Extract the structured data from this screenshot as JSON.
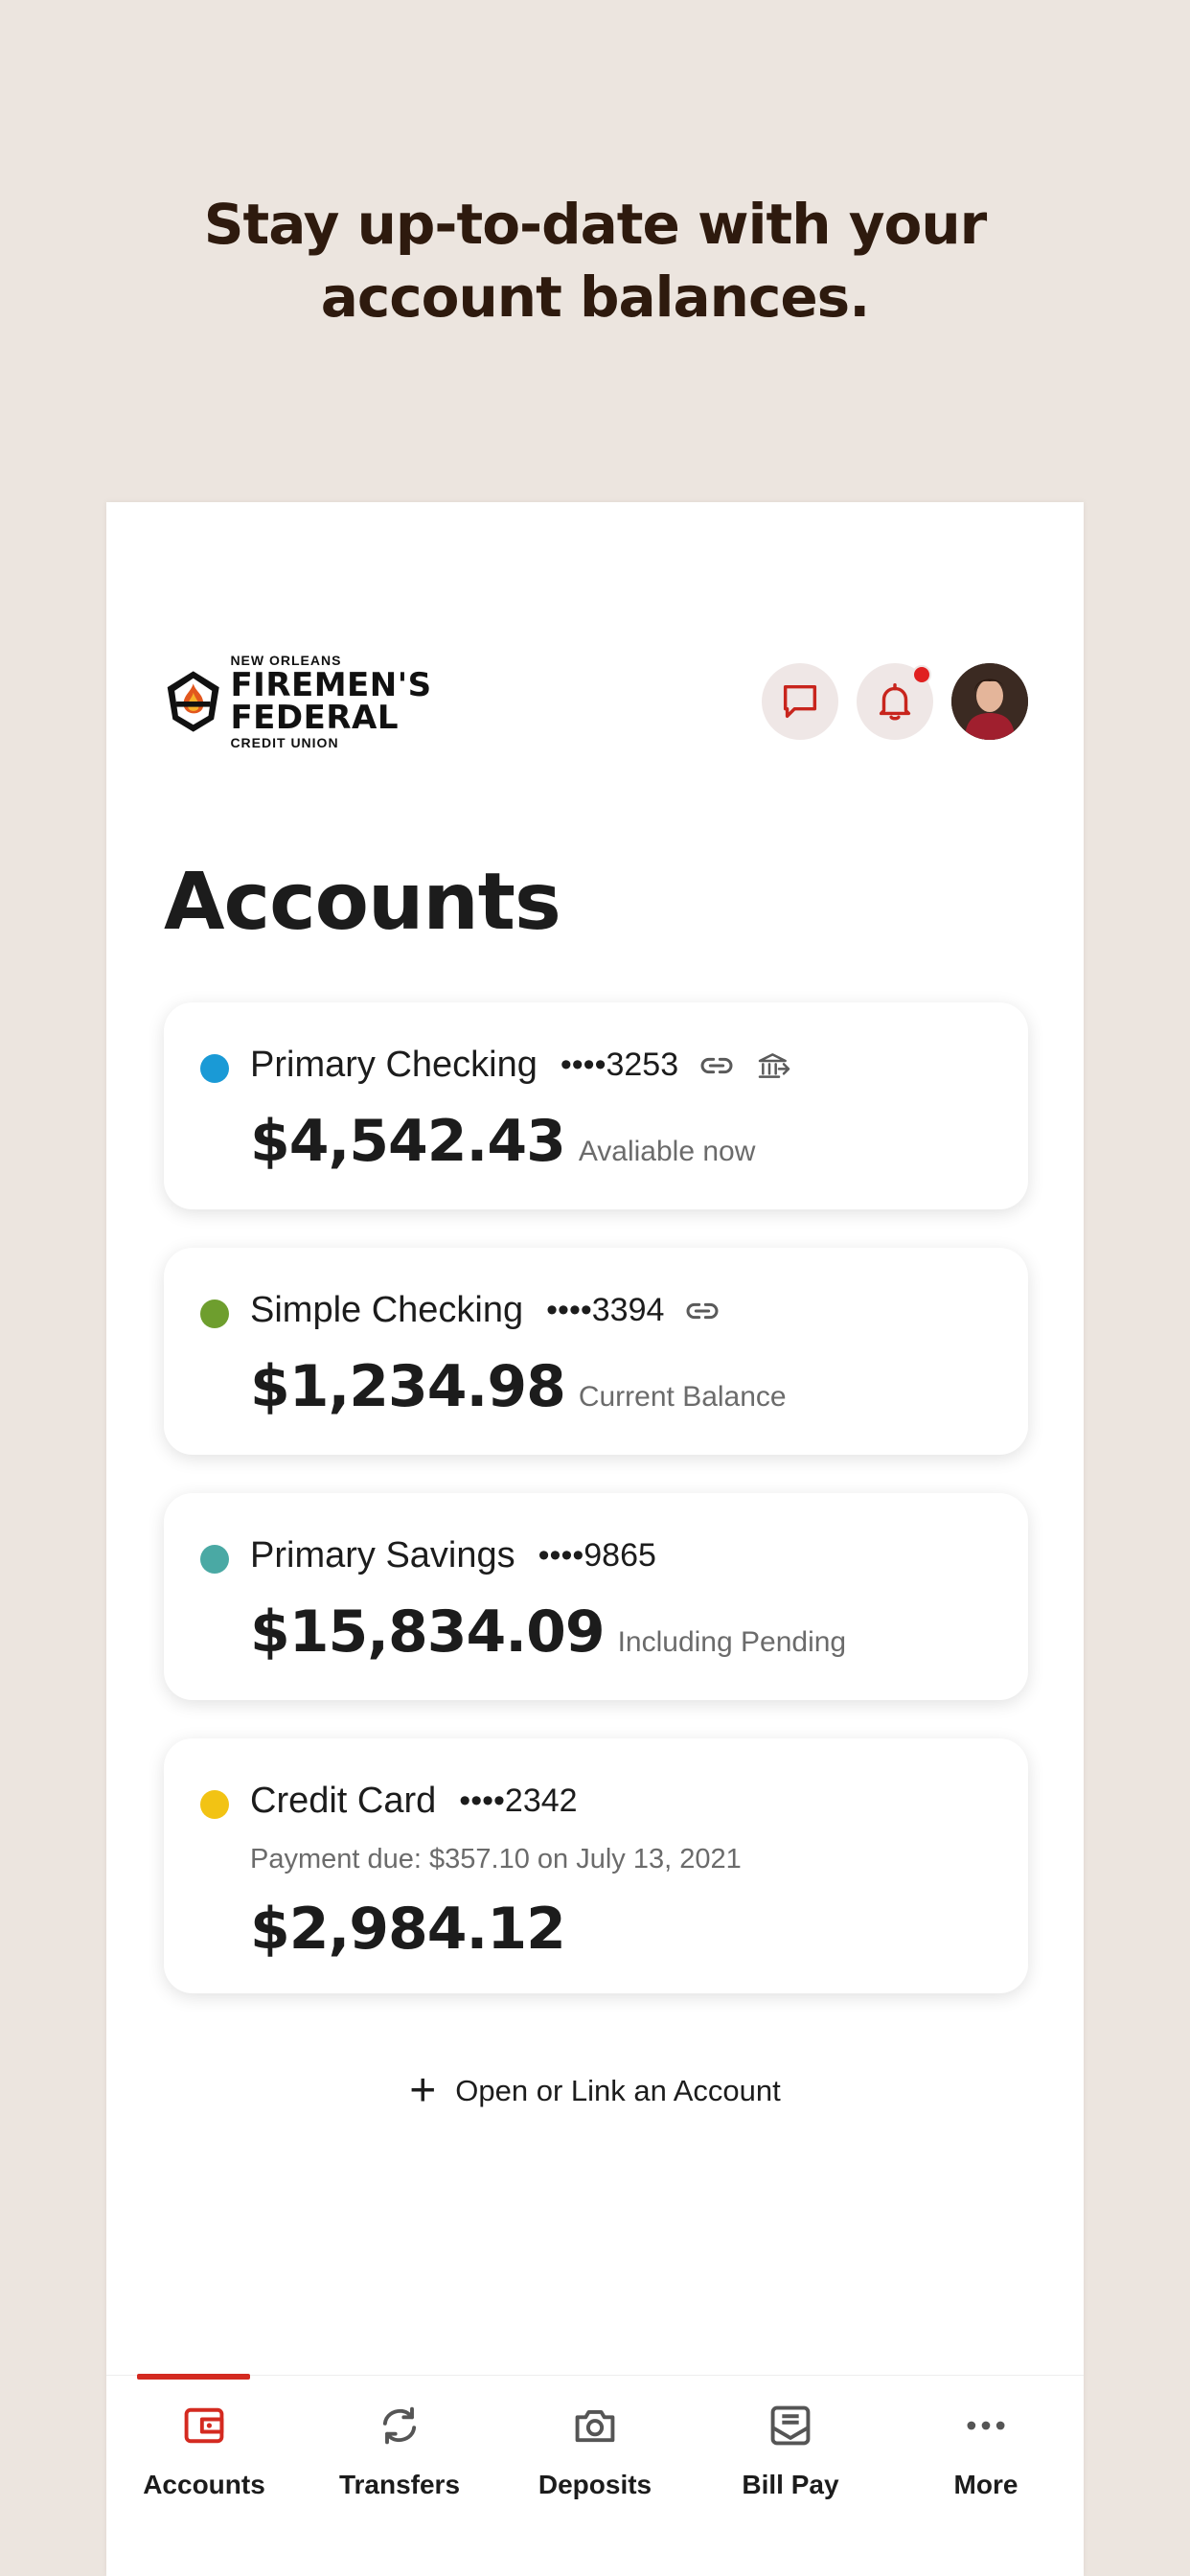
{
  "promo": {
    "headline_line1": "Stay up-to-date with your",
    "headline_line2": "account balances."
  },
  "header": {
    "logo": {
      "top_text": "NEW ORLEANS",
      "main_text": "FIREMEN'S FEDERAL",
      "bottom_text": "CREDIT UNION"
    },
    "icons": [
      "chat-icon",
      "bell-icon",
      "avatar"
    ],
    "notification_badge": true
  },
  "page": {
    "title": "Accounts"
  },
  "accounts": [
    {
      "name": "Primary Checking",
      "mask": "••••3253",
      "amount": "$4,542.43",
      "note": "Avaliable now",
      "color": "#1a9ad6",
      "icons": [
        "link-icon",
        "bank-transfer-icon"
      ]
    },
    {
      "name": "Simple Checking",
      "mask": "••••3394",
      "amount": "$1,234.98",
      "note": "Current Balance",
      "color": "#6e9e2e",
      "icons": [
        "link-icon"
      ]
    },
    {
      "name": "Primary Savings",
      "mask": "••••9865",
      "amount": "$15,834.09",
      "note": "Including Pending",
      "color": "#4aa9a4",
      "icons": []
    },
    {
      "name": "Credit Card",
      "mask": "••••2342",
      "due_text": "Payment due: $357.10 on July 13, 2021",
      "amount": "$2,984.12",
      "color": "#f2c314",
      "icons": []
    }
  ],
  "open_link": {
    "label": "Open or Link an Account"
  },
  "bottom_nav": {
    "active_color": "#d42a20",
    "items": [
      {
        "label": "Accounts",
        "icon": "wallet-icon",
        "active": true
      },
      {
        "label": "Transfers",
        "icon": "transfer-icon",
        "active": false
      },
      {
        "label": "Deposits",
        "icon": "camera-icon",
        "active": false
      },
      {
        "label": "Bill Pay",
        "icon": "bill-icon",
        "active": false
      },
      {
        "label": "More",
        "icon": "more-icon",
        "active": false
      }
    ]
  }
}
